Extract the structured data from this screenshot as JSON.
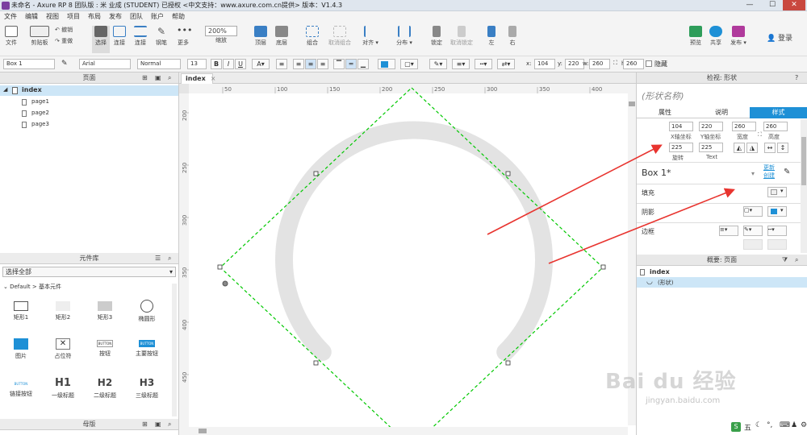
{
  "window": {
    "title": "未命名 - Axure RP 8 团队版 : 米 业成 (STUDENT) 已授权   <中文支持：www.axure.com.cn提供> 版本：V1.4.3",
    "min": "—",
    "max": "☐",
    "close": "✕"
  },
  "menu": [
    "文件",
    "编辑",
    "视图",
    "项目",
    "布局",
    "发布",
    "团队",
    "账户",
    "帮助"
  ],
  "toolbar": {
    "file": "文件",
    "clipboard": "剪贴板",
    "undo": "撤销",
    "redo": "重做",
    "select": "选择",
    "connect": "连接",
    "pen": "钢笔",
    "more": "更多",
    "zoom_value": "200%",
    "zoom_label": "缩放",
    "top": "顶层",
    "bottom": "底层",
    "group": "组合",
    "ungroup": "取消组合",
    "align": "对齐",
    "distribute": "分布",
    "lock": "锁定",
    "unlock": "取消锁定",
    "left": "左",
    "right": "右",
    "preview": "预览",
    "share": "共享",
    "publish": "发布",
    "login": "登录"
  },
  "format": {
    "widget_name": "Box 1",
    "font": "Arial",
    "weight": "Normal",
    "size": "13",
    "bold": "B",
    "italic": "I",
    "underline": "U",
    "x_label": "x:",
    "x": "104",
    "y_label": "y:",
    "y": "220",
    "w_label": "w:",
    "w": "260",
    "h_label": "h:",
    "h": "260",
    "hidden": "隐藏"
  },
  "pages": {
    "header": "页面",
    "root": "index",
    "items": [
      "page1",
      "page2",
      "page3"
    ]
  },
  "library": {
    "header": "元件库",
    "select": "选择全部",
    "group": "Default > 基本元件",
    "widgets": [
      "矩形1",
      "矩形2",
      "矩形3",
      "椭圆形",
      "图片",
      "占位符",
      "按钮",
      "主要按钮",
      "链接按钮",
      "一级标题",
      "二级标题",
      "三级标题"
    ],
    "btn_text": "BUTTON",
    "h1": "H1",
    "h2": "H2",
    "h3": "H3"
  },
  "masters": {
    "header": "母版"
  },
  "canvas": {
    "tab": "index",
    "ruler_top": [
      "50",
      "100",
      "150",
      "200",
      "250",
      "300",
      "350",
      "400"
    ],
    "ruler_left": [
      "200",
      "250",
      "300",
      "350",
      "400",
      "450"
    ]
  },
  "inspector": {
    "header": "检视: 形状",
    "shape_name_placeholder": "(形状名称)",
    "tabs": [
      "属性",
      "说明",
      "样式"
    ],
    "x": "104",
    "y": "220",
    "w": "260",
    "h": "260",
    "x_lbl": "X轴坐标",
    "y_lbl": "Y轴坐标",
    "w_lbl": "宽度",
    "h_lbl": "高度",
    "rotate": "225",
    "text_rotate": "225",
    "rotate_lbl": "旋转",
    "text_lbl": "Text",
    "style_name": "Box 1*",
    "update": "更新",
    "create": "创建",
    "fill": "填充",
    "shadow": "阴影",
    "border": "边框"
  },
  "outline": {
    "header": "概要: 页面",
    "root": "index",
    "item": "(形状)"
  },
  "taskbar": {
    "ime": "五"
  },
  "watermark": {
    "brand": "Bai du 经验",
    "url": "jingyan.baidu.com"
  },
  "colors": {
    "accent": "#1e90d6",
    "selection": "#00c800",
    "arc": "#e3e3e3",
    "arrow": "#e8342f"
  }
}
